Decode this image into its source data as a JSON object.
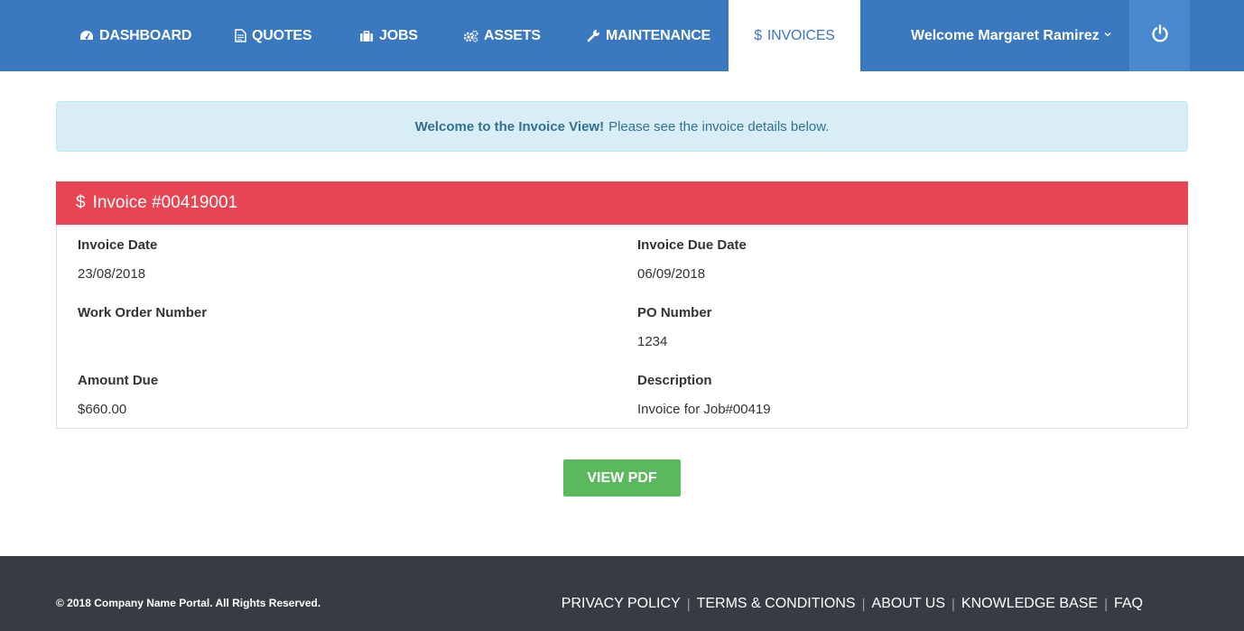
{
  "nav": {
    "items": [
      {
        "label": "DASHBOARD",
        "icon": "dashboard-icon"
      },
      {
        "label": "QUOTES",
        "icon": "document-icon"
      },
      {
        "label": "JOBS",
        "icon": "briefcase-icon"
      },
      {
        "label": "ASSETS",
        "icon": "cogs-icon"
      },
      {
        "label": "MAINTENANCE",
        "icon": "wrench-icon"
      },
      {
        "label": "INVOICES",
        "icon": "dollar-icon",
        "active": true
      }
    ],
    "user_label": "Welcome Margaret Ramirez",
    "user_icon": "chevron-down-icon",
    "power_icon": "power-icon"
  },
  "alert": {
    "bold": "Welcome to the Invoice View!",
    "text": "Please see the invoice details below."
  },
  "invoice": {
    "icon": "dollar-icon",
    "title": "Invoice #00419001",
    "invoice_date_label": "Invoice Date",
    "invoice_date": "23/08/2018",
    "due_date_label": "Invoice Due Date",
    "due_date": "06/09/2018",
    "work_order_label": "Work Order Number",
    "work_order": "",
    "po_label": "PO Number",
    "po": "1234",
    "amount_label": "Amount Due",
    "amount": "$660.00",
    "description_label": "Description",
    "description": "Invoice for Job#00419"
  },
  "actions": {
    "view_pdf": "VIEW PDF"
  },
  "footer": {
    "copyright": "© 2018 Company Name Portal. All Rights Reserved.",
    "links": [
      "PRIVACY POLICY",
      "TERMS & CONDITIONS",
      "ABOUT US",
      "KNOWLEDGE BASE",
      "FAQ"
    ]
  },
  "colors": {
    "nav_bg": "#3a78bf",
    "panel_header": "#e84553",
    "button": "#5cb85c",
    "footer_bg": "#373c44",
    "alert_bg": "#d9edf7"
  }
}
